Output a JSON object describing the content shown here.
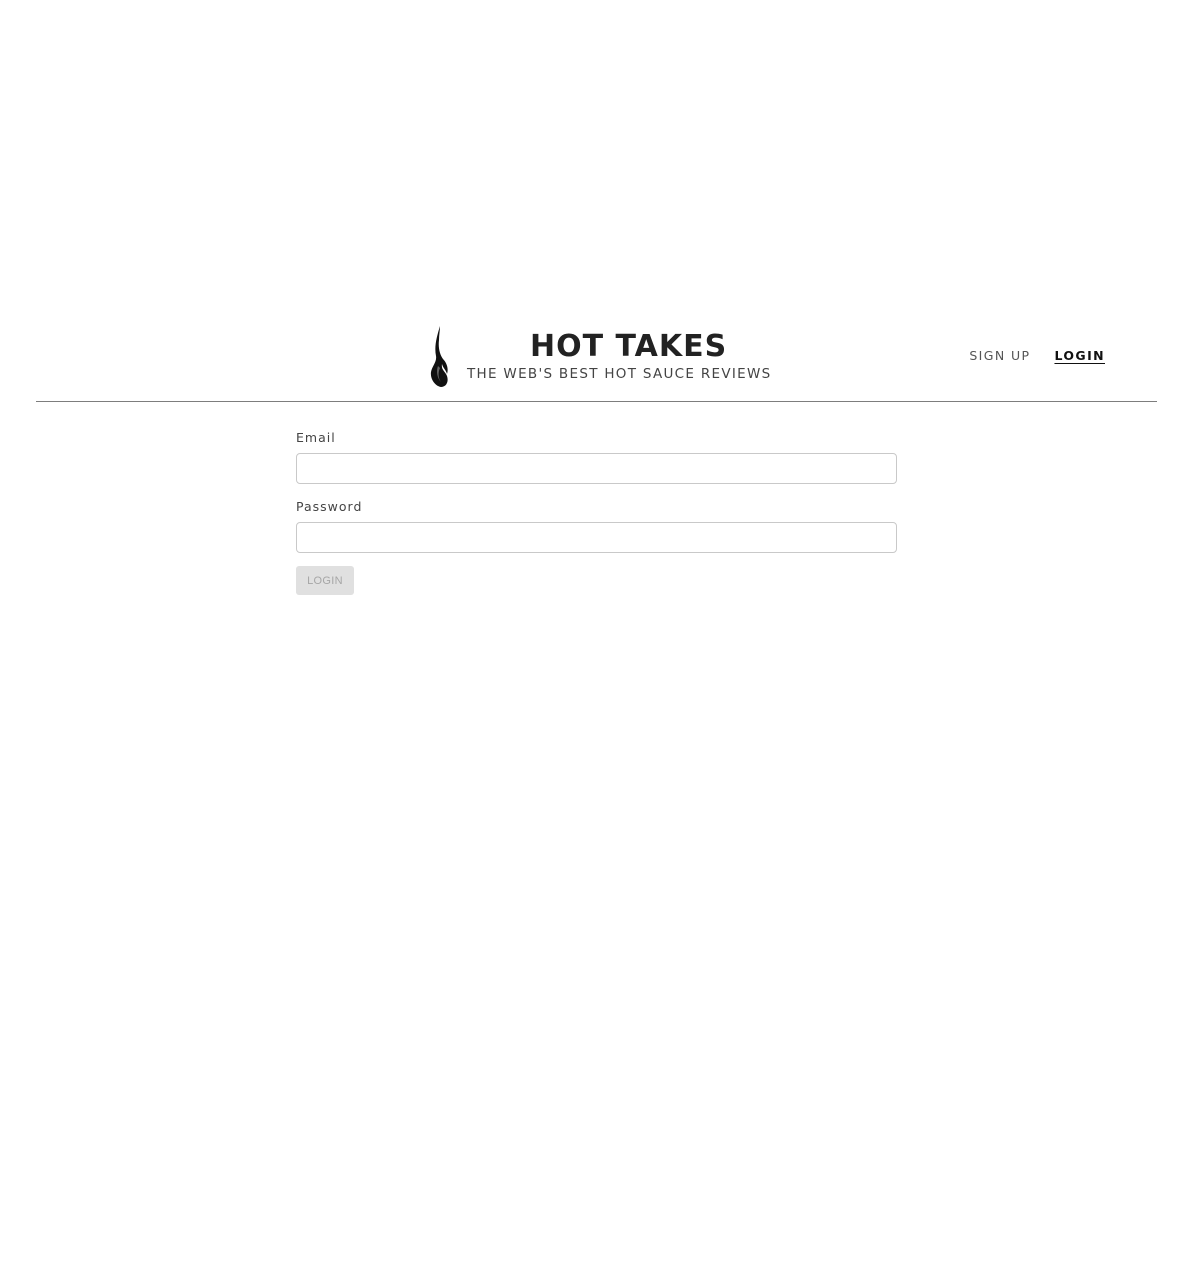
{
  "header": {
    "logo_icon": "flame-icon",
    "title": "HOT TAKES",
    "tagline": "THE WEB'S BEST HOT SAUCE REVIEWS",
    "nav": {
      "signup_label": "SIGN UP",
      "login_label": "LOGIN",
      "active": "login"
    }
  },
  "form": {
    "email": {
      "label": "Email",
      "value": "",
      "placeholder": ""
    },
    "password": {
      "label": "Password",
      "value": "",
      "placeholder": ""
    },
    "submit_label": "LOGIN",
    "submit_disabled": true
  },
  "colors": {
    "text_dark": "#222222",
    "divider": "#7d7d7d",
    "input_border": "#c9c9c9",
    "button_disabled_bg": "#e0e0e0",
    "button_disabled_text": "#a6a6a6"
  }
}
